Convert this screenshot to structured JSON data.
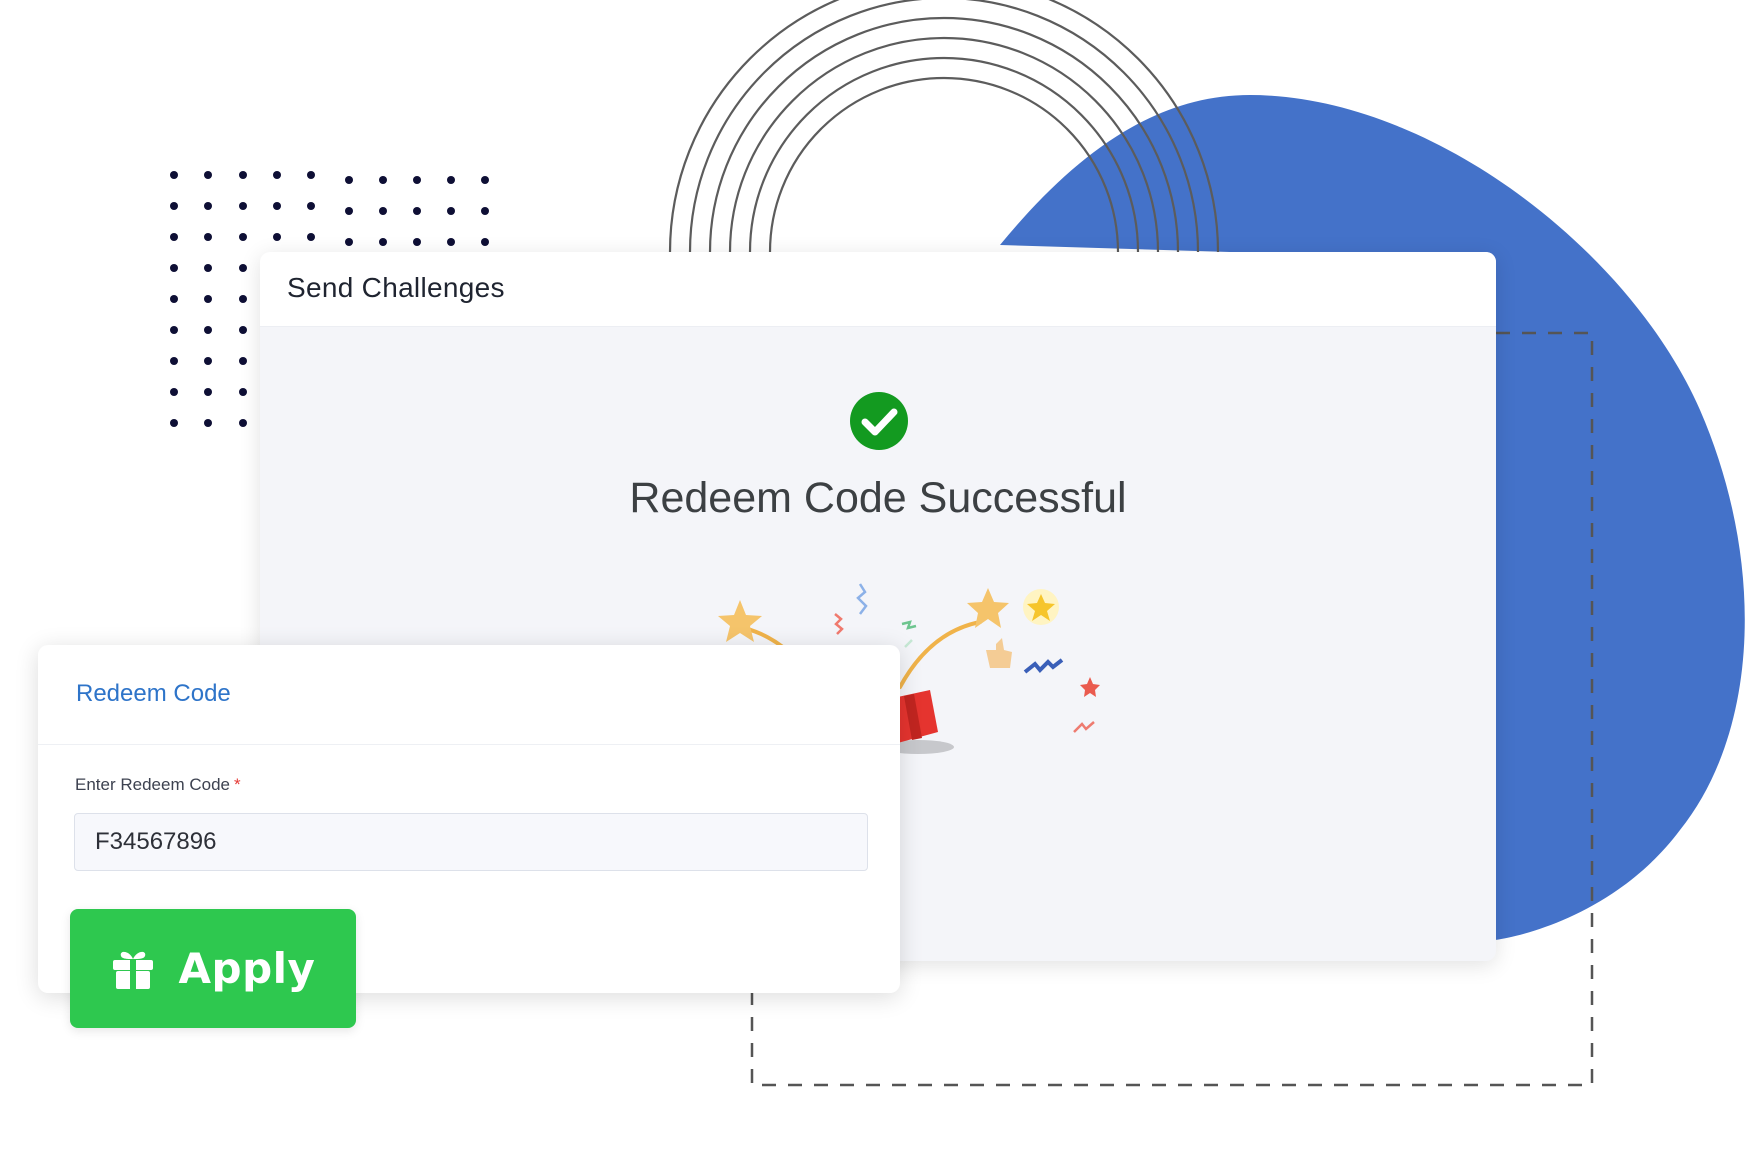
{
  "colors": {
    "blob": "#4472c9",
    "accent_blue": "#2e74c9",
    "success_green": "#139a20",
    "apply_green": "#2ec84f",
    "dot_color": "#0e0f35"
  },
  "challenge_panel": {
    "title": "Send Challenges",
    "status_icon": "check-circle-icon",
    "success_message": "Redeem Code Successful",
    "illustration": "celebration-gift-confetti"
  },
  "redeem_panel": {
    "title": "Redeem Code",
    "field_label": "Enter Redeem Code",
    "required_marker": "*",
    "code_value": "F34567896",
    "apply_label": "Apply",
    "apply_icon": "gift-icon"
  }
}
